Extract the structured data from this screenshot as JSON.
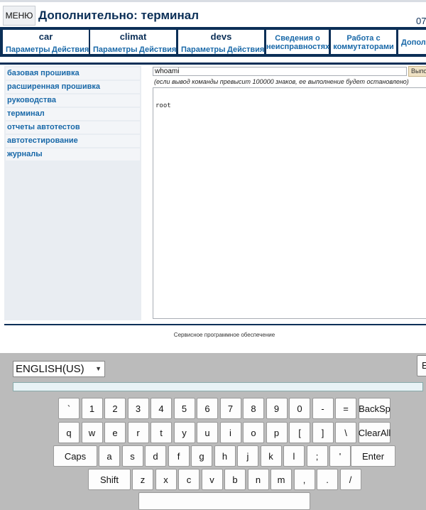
{
  "header": {
    "menu_label": "МЕНЮ",
    "title": "Дополнительно: терминал",
    "time_fragment": "07"
  },
  "nav": {
    "groups": [
      {
        "title": "car",
        "items": [
          "Параметры",
          "Действия"
        ]
      },
      {
        "title": "climat",
        "items": [
          "Параметры",
          "Действия"
        ]
      },
      {
        "title": "devs",
        "items": [
          "Параметры",
          "Действия"
        ]
      }
    ],
    "links": [
      {
        "line1": "Сведения о",
        "line2": "неисправностях"
      },
      {
        "line1": "Работа с",
        "line2": "коммутаторами"
      },
      {
        "line1": "Допол",
        "line2": ""
      }
    ]
  },
  "sidebar": {
    "items": [
      {
        "label": "базовая прошивка"
      },
      {
        "label": "расширенная прошивка"
      },
      {
        "label": "руководства"
      },
      {
        "label": "терминал"
      },
      {
        "label": "отчеты автотестов"
      },
      {
        "label": "автотестирование"
      },
      {
        "label": "журналы"
      }
    ]
  },
  "terminal": {
    "command": "whoami",
    "run_label": "Выполнить",
    "note": "(если вывод команды превысит 100000 знаков, ее выполнение будет остановлено)",
    "output": "root"
  },
  "footer": {
    "text": "Сервисное программное обеспечение"
  },
  "keyboard": {
    "language": "ENGLISH(US)",
    "side_key": "E",
    "row1": [
      "`",
      "1",
      "2",
      "3",
      "4",
      "5",
      "6",
      "7",
      "8",
      "9",
      "0",
      "-",
      "=",
      "BackSp"
    ],
    "row2": [
      "q",
      "w",
      "e",
      "r",
      "t",
      "y",
      "u",
      "i",
      "o",
      "p",
      "[",
      "]",
      "\\",
      "ClearAll"
    ],
    "row3": [
      "Caps",
      "a",
      "s",
      "d",
      "f",
      "g",
      "h",
      "j",
      "k",
      "l",
      ";",
      "'",
      "Enter"
    ],
    "row4": [
      "Shift",
      "z",
      "x",
      "c",
      "v",
      "b",
      "n",
      "m",
      ",",
      ".",
      "/"
    ],
    "space": ""
  }
}
